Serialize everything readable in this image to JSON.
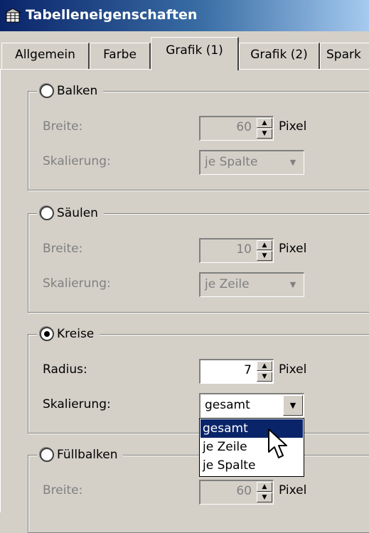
{
  "window": {
    "title": "Tabelleneigenschaften"
  },
  "tabs": [
    {
      "label": "Allgemein"
    },
    {
      "label": "Farbe"
    },
    {
      "label": "Grafik (1)",
      "active": true
    },
    {
      "label": "Grafik (2)"
    },
    {
      "label": "Spark"
    }
  ],
  "groups": {
    "balken": {
      "title": "Balken",
      "selected": false,
      "width_label": "Breite:",
      "width_value": "60",
      "unit": "Pixel",
      "scale_label": "Skalierung:",
      "scale_value": "je Spalte"
    },
    "saeulen": {
      "title": "Säulen",
      "selected": false,
      "width_label": "Breite:",
      "width_value": "10",
      "unit": "Pixel",
      "scale_label": "Skalierung:",
      "scale_value": "je Zeile"
    },
    "kreise": {
      "title": "Kreise",
      "selected": true,
      "radius_label": "Radius:",
      "radius_value": "7",
      "unit": "Pixel",
      "scale_label": "Skalierung:",
      "scale_value": "gesamt"
    },
    "fuellbalken": {
      "title": "Füllbalken",
      "selected": false,
      "width_label": "Breite:",
      "width_value": "60",
      "unit": "Pixel"
    }
  },
  "dropdown": {
    "options": [
      "gesamt",
      "je Zeile",
      "je Spalte"
    ],
    "highlighted": "gesamt"
  },
  "colors": {
    "title_start": "#0a246a",
    "title_end": "#a6caf0",
    "highlight": "#0a246a",
    "face": "#d4d0c8"
  }
}
